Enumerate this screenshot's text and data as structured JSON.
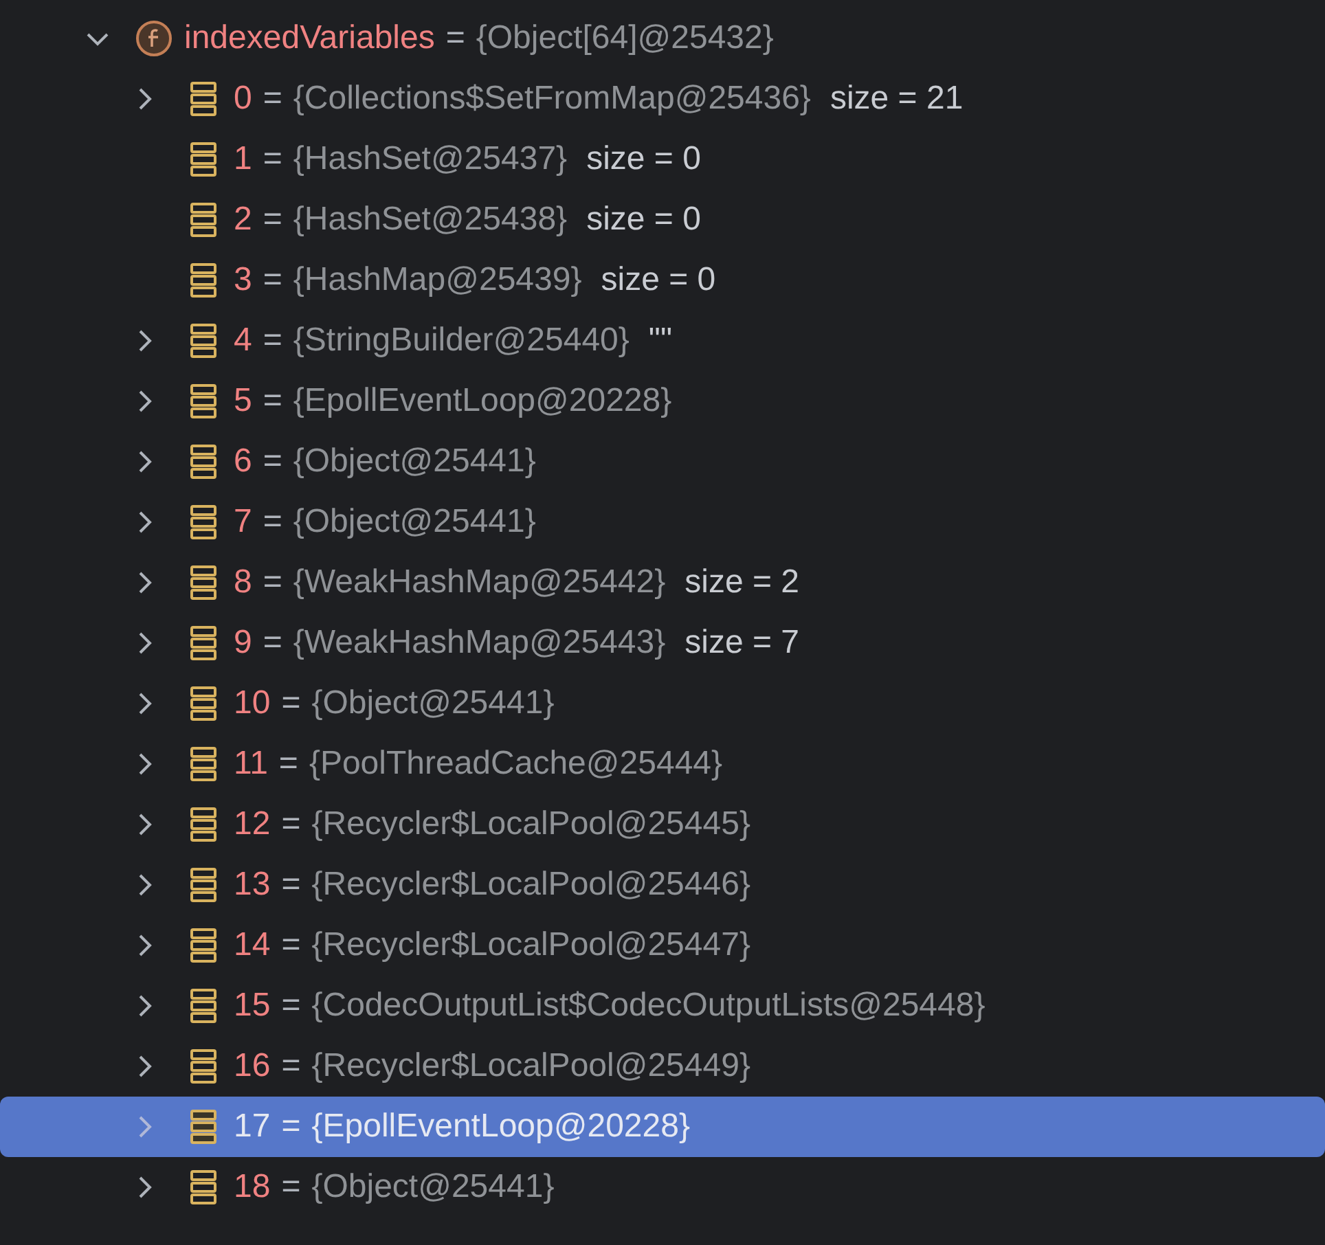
{
  "root": {
    "name": "indexedVariables",
    "operator": "=",
    "value": "{Object[64]@25432}",
    "expanded": true,
    "children": [
      {
        "name": "0",
        "operator": "=",
        "value": "{Collections$SetFromMap@25436}",
        "extra": "size = 21",
        "expandable": true,
        "selected": false
      },
      {
        "name": "1",
        "operator": "=",
        "value": "{HashSet@25437}",
        "extra": "size = 0",
        "expandable": false,
        "selected": false
      },
      {
        "name": "2",
        "operator": "=",
        "value": "{HashSet@25438}",
        "extra": "size = 0",
        "expandable": false,
        "selected": false
      },
      {
        "name": "3",
        "operator": "=",
        "value": "{HashMap@25439}",
        "extra": "size = 0",
        "expandable": false,
        "selected": false
      },
      {
        "name": "4",
        "operator": "=",
        "value": "{StringBuilder@25440}",
        "extra": "\"\"",
        "expandable": true,
        "selected": false
      },
      {
        "name": "5",
        "operator": "=",
        "value": "{EpollEventLoop@20228}",
        "expandable": true,
        "selected": false
      },
      {
        "name": "6",
        "operator": "=",
        "value": "{Object@25441}",
        "expandable": true,
        "selected": false
      },
      {
        "name": "7",
        "operator": "=",
        "value": "{Object@25441}",
        "expandable": true,
        "selected": false
      },
      {
        "name": "8",
        "operator": "=",
        "value": "{WeakHashMap@25442}",
        "extra": "size = 2",
        "expandable": true,
        "selected": false
      },
      {
        "name": "9",
        "operator": "=",
        "value": "{WeakHashMap@25443}",
        "extra": "size = 7",
        "expandable": true,
        "selected": false
      },
      {
        "name": "10",
        "operator": "=",
        "value": "{Object@25441}",
        "expandable": true,
        "selected": false
      },
      {
        "name": "11",
        "operator": "=",
        "value": "{PoolThreadCache@25444}",
        "expandable": true,
        "selected": false
      },
      {
        "name": "12",
        "operator": "=",
        "value": "{Recycler$LocalPool@25445}",
        "expandable": true,
        "selected": false
      },
      {
        "name": "13",
        "operator": "=",
        "value": "{Recycler$LocalPool@25446}",
        "expandable": true,
        "selected": false
      },
      {
        "name": "14",
        "operator": "=",
        "value": "{Recycler$LocalPool@25447}",
        "expandable": true,
        "selected": false
      },
      {
        "name": "15",
        "operator": "=",
        "value": "{CodecOutputList$CodecOutputLists@25448}",
        "expandable": true,
        "selected": false
      },
      {
        "name": "16",
        "operator": "=",
        "value": "{Recycler$LocalPool@25449}",
        "expandable": true,
        "selected": false
      },
      {
        "name": "17",
        "operator": "=",
        "value": "{EpollEventLoop@20228}",
        "expandable": true,
        "selected": true
      },
      {
        "name": "18",
        "operator": "=",
        "value": "{Object@25441}",
        "expandable": true,
        "selected": false
      }
    ]
  }
}
